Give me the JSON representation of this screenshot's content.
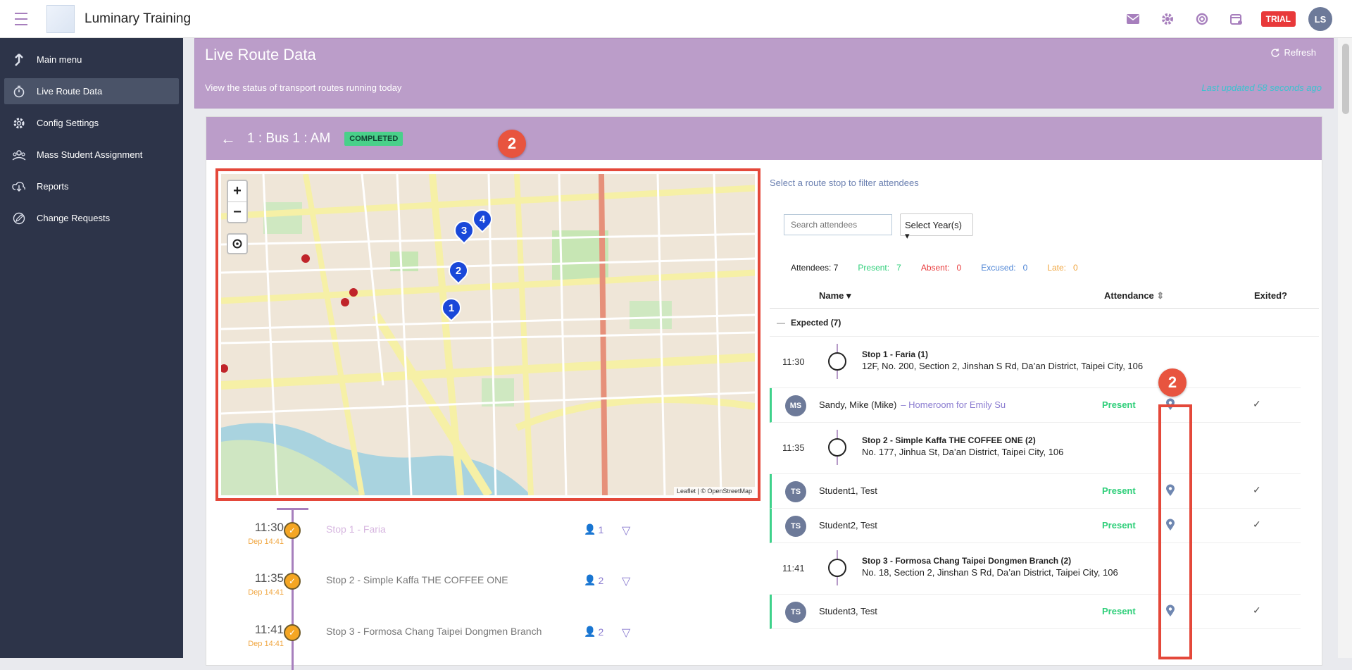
{
  "app": {
    "title": "Luminary Training",
    "trial_label": "TRIAL",
    "user_initials": "LS"
  },
  "sidebar": {
    "items": [
      {
        "label": "Main menu",
        "icon": "arrow-up-icon"
      },
      {
        "label": "Live Route Data",
        "icon": "stopwatch-icon",
        "active": true
      },
      {
        "label": "Config Settings",
        "icon": "gear-icon"
      },
      {
        "label": "Mass Student Assignment",
        "icon": "group-icon"
      },
      {
        "label": "Reports",
        "icon": "download-icon"
      },
      {
        "label": "Change Requests",
        "icon": "edit-icon"
      }
    ]
  },
  "banner": {
    "title": "Live Route Data",
    "subtitle": "View the status of transport routes running today",
    "refresh_label": "Refresh",
    "last_updated": "Last updated 58 seconds ago"
  },
  "route": {
    "title": "1 : Bus 1 : AM",
    "status": "COMPLETED"
  },
  "map": {
    "zoom_in": "+",
    "zoom_out": "−",
    "attribution": "Leaflet | © OpenStreetMap",
    "markers": [
      "1",
      "2",
      "3",
      "4"
    ]
  },
  "annotations": {
    "map_badge": "2",
    "column_badge": "2"
  },
  "timeline": [
    {
      "time": "11:30",
      "dep": "Dep 14:41",
      "name": "Stop 1 - Faria",
      "count": "1",
      "faded": true
    },
    {
      "time": "11:35",
      "dep": "Dep 14:41",
      "name": "Stop 2 - Simple Kaffa THE COFFEE ONE",
      "count": "2"
    },
    {
      "time": "11:41",
      "dep": "Dep 14:41",
      "name": "Stop 3 - Formosa Chang Taipei Dongmen Branch",
      "count": "2"
    }
  ],
  "attendees_panel": {
    "hint": "Select a route stop to filter attendees",
    "search_placeholder": "Search attendees",
    "year_select": "Select Year(s)",
    "stats": {
      "attendees_label": "Attendees:",
      "attendees": "7",
      "present_label": "Present:",
      "present": "7",
      "absent_label": "Absent:",
      "absent": "0",
      "excused_label": "Excused:",
      "excused": "0",
      "late_label": "Late:",
      "late": "0"
    },
    "columns": {
      "name": "Name",
      "attendance": "Attendance",
      "exited": "Exited?"
    },
    "group_label": "Expected (7)",
    "stops": [
      {
        "time": "11:30",
        "title": "Stop 1 - Faria (1)",
        "address": "12F, No. 200, Section 2, Jinshan S Rd, Da’an District, Taipei City, 106"
      },
      {
        "time": "11:35",
        "title": "Stop 2 - Simple Kaffa THE COFFEE ONE (2)",
        "address": "No. 177, Jinhua St, Da’an District, Taipei City, 106"
      },
      {
        "time": "11:41",
        "title": "Stop 3 - Formosa Chang Taipei Dongmen Branch (2)",
        "address": "No. 18, Section 2, Jinshan S Rd, Da’an District, Taipei City, 106"
      }
    ],
    "attendees": [
      {
        "initials": "MS",
        "name": "Sandy, Mike (Mike)",
        "homeroom": "– Homeroom for Emily Su",
        "status": "Present",
        "exited": "✓"
      },
      {
        "initials": "TS",
        "name": "Student1, Test",
        "homeroom": "",
        "status": "Present",
        "exited": "✓"
      },
      {
        "initials": "TS",
        "name": "Student2, Test",
        "homeroom": "",
        "status": "Present",
        "exited": "✓"
      },
      {
        "initials": "TS",
        "name": "Student3, Test",
        "homeroom": "",
        "status": "Present",
        "exited": "✓"
      }
    ]
  },
  "colors": {
    "accent": "#bb9dc9",
    "sidebar": "#2d3449",
    "present": "#2fcf7a",
    "absent": "#e8393a",
    "excused": "#4f86d6",
    "late": "#f0a640",
    "annotation": "#e4483a"
  }
}
